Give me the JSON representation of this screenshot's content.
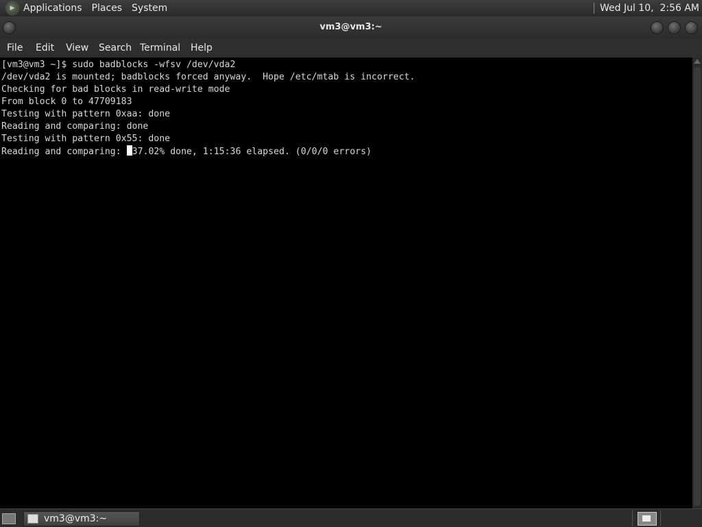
{
  "top_panel": {
    "menus": [
      "Applications",
      "Places",
      "System"
    ],
    "clock": "Wed Jul 10,  2:56 AM"
  },
  "window": {
    "title": "vm3@vm3:~"
  },
  "menubar": [
    "File",
    "Edit",
    "View",
    "Search",
    "Terminal",
    "Help"
  ],
  "terminal": {
    "lines": [
      "[vm3@vm3 ~]$ sudo badblocks -wfsv /dev/vda2",
      "/dev/vda2 is mounted; badblocks forced anyway.  Hope /etc/mtab is incorrect.",
      "Checking for bad blocks in read-write mode",
      "From block 0 to 47709183",
      "Testing with pattern 0xaa: done",
      "Reading and comparing: done",
      "Testing with pattern 0x55: done"
    ],
    "progress_prefix": "Reading and comparing: ",
    "progress_suffix": "37.02% done, 1:15:36 elapsed. (0/0/0 errors)"
  },
  "bottom_panel": {
    "task_label": "vm3@vm3:~"
  }
}
